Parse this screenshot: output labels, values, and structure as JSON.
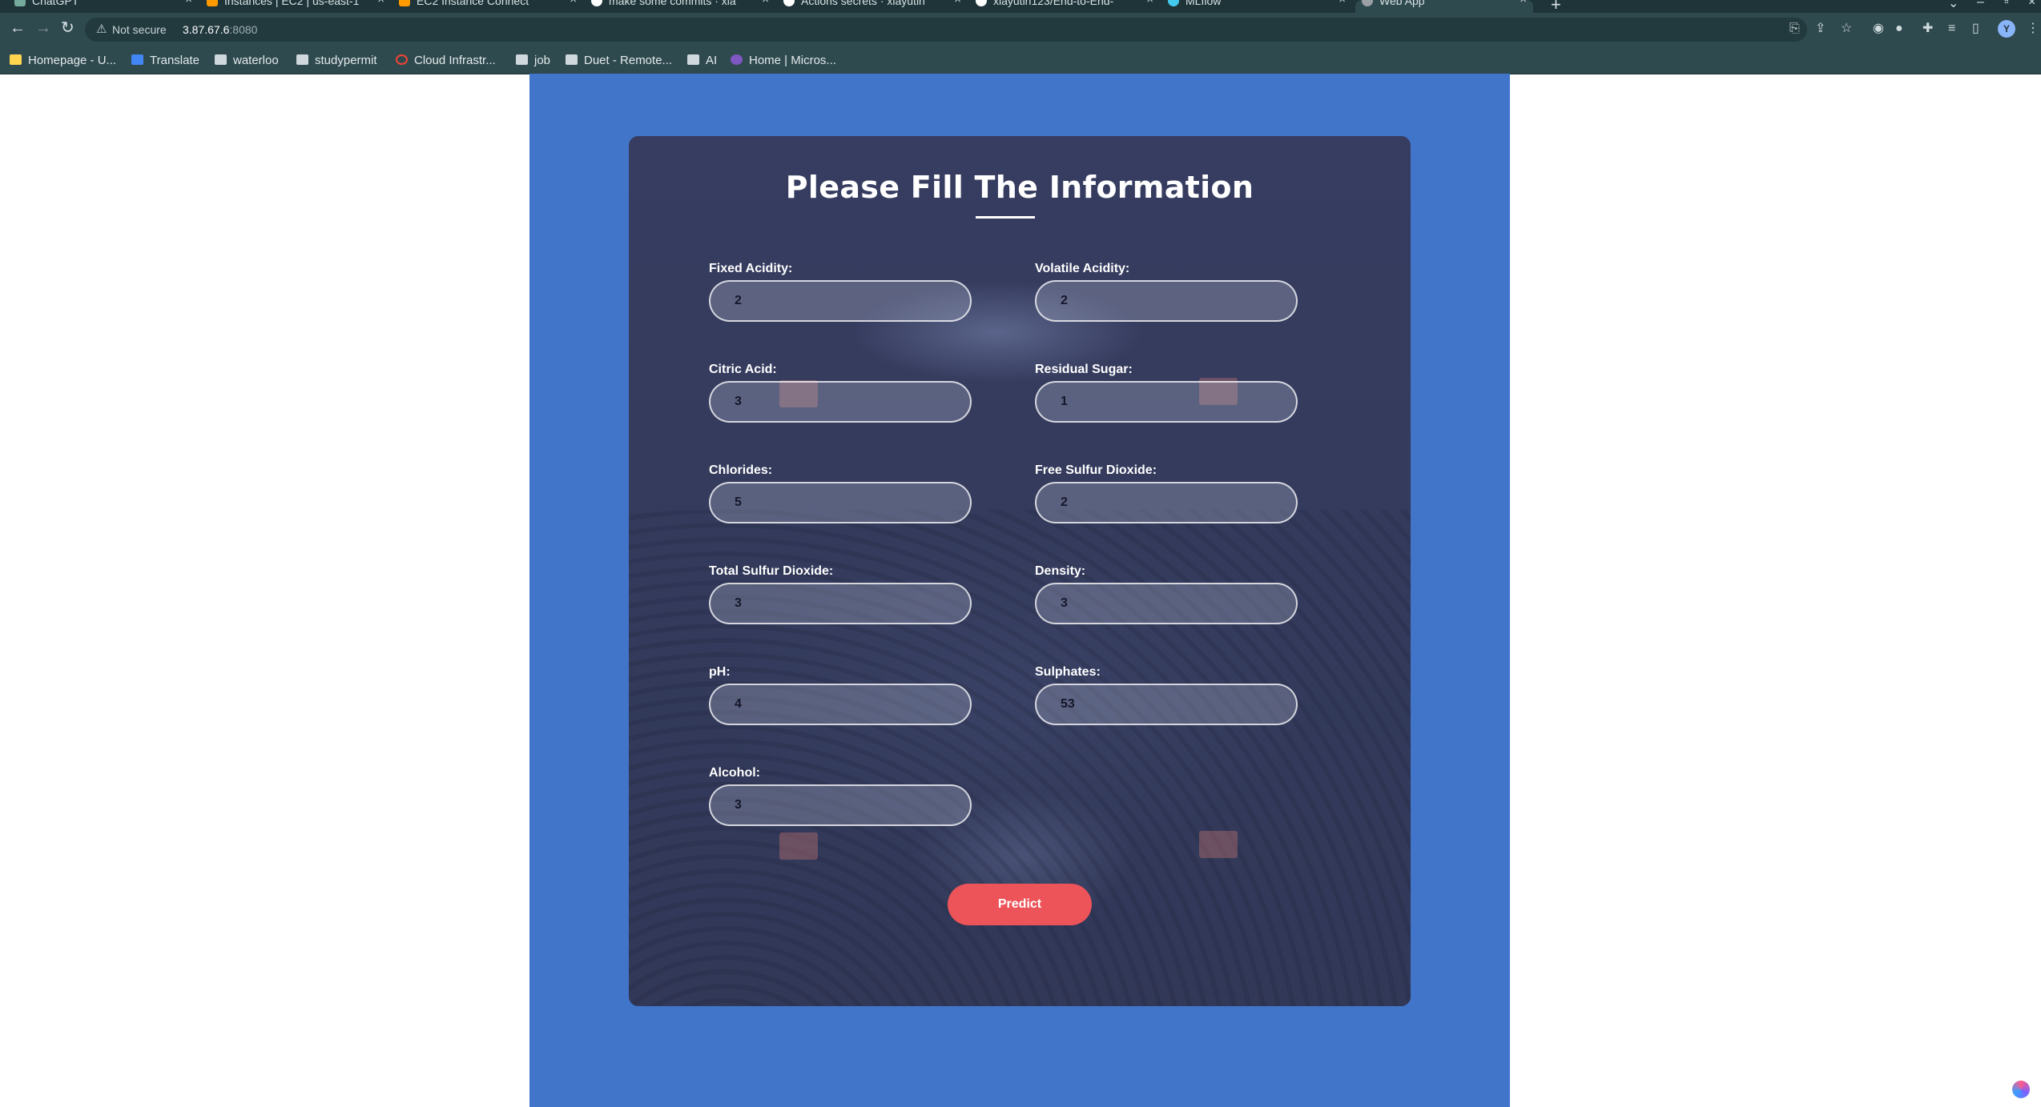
{
  "browser": {
    "tabs": [
      {
        "title": "ChatGPT",
        "color": "#74aa9c",
        "active": false
      },
      {
        "title": "Instances | EC2 | us-east-1",
        "color": "#f90",
        "active": false
      },
      {
        "title": "EC2 Instance Connect",
        "color": "#f90",
        "active": false
      },
      {
        "title": "make some commits · xia",
        "color": "#ffffff",
        "active": false
      },
      {
        "title": "Actions secrets · xiayutin",
        "color": "#ffffff",
        "active": false
      },
      {
        "title": "xiayutin123/End-to-End-",
        "color": "#ffffff",
        "active": false
      },
      {
        "title": "MLflow",
        "color": "#43c9ed",
        "active": false
      },
      {
        "title": "Web App",
        "color": "#9aa0a6",
        "active": true
      }
    ],
    "address": {
      "security_label": "Not secure",
      "host": "3.87.67.6",
      "port": ":8080"
    },
    "bookmarks": [
      {
        "label": "Homepage - U...",
        "color": "#ffd54f"
      },
      {
        "label": "Translate",
        "color": "#4285f4"
      },
      {
        "label": "waterloo",
        "color": "#cfd8dc"
      },
      {
        "label": "studypermit",
        "color": "#cfd8dc"
      },
      {
        "label": "Cloud Infrastr...",
        "color": "#f44336"
      },
      {
        "label": "job",
        "color": "#cfd8dc"
      },
      {
        "label": "Duet - Remote...",
        "color": "#cfd8dc"
      },
      {
        "label": "AI",
        "color": "#cfd8dc"
      },
      {
        "label": "Home | Micros...",
        "color": "#7e57c2"
      }
    ]
  },
  "form": {
    "title": "Please Fill The Information",
    "fields": {
      "fixed_acidity": {
        "label": "Fixed Acidity:",
        "value": "2"
      },
      "volatile_acidity": {
        "label": "Volatile Acidity:",
        "value": "2"
      },
      "citric_acid": {
        "label": "Citric Acid:",
        "value": "3"
      },
      "residual_sugar": {
        "label": "Residual Sugar:",
        "value": "1"
      },
      "chlorides": {
        "label": "Chlorides:",
        "value": "5"
      },
      "free_sulfur_dioxide": {
        "label": "Free Sulfur Dioxide:",
        "value": "2"
      },
      "total_sulfur_dioxide": {
        "label": "Total Sulfur Dioxide:",
        "value": "3"
      },
      "density": {
        "label": "Density:",
        "value": "3"
      },
      "ph": {
        "label": "pH:",
        "value": "4"
      },
      "sulphates": {
        "label": "Sulphates:",
        "value": "53"
      },
      "alcohol": {
        "label": "Alcohol:",
        "value": "3"
      }
    },
    "submit_label": "Predict"
  },
  "colors": {
    "page_background": "#4075c9",
    "card_background": "#363b5d",
    "button": "#ec5459"
  }
}
